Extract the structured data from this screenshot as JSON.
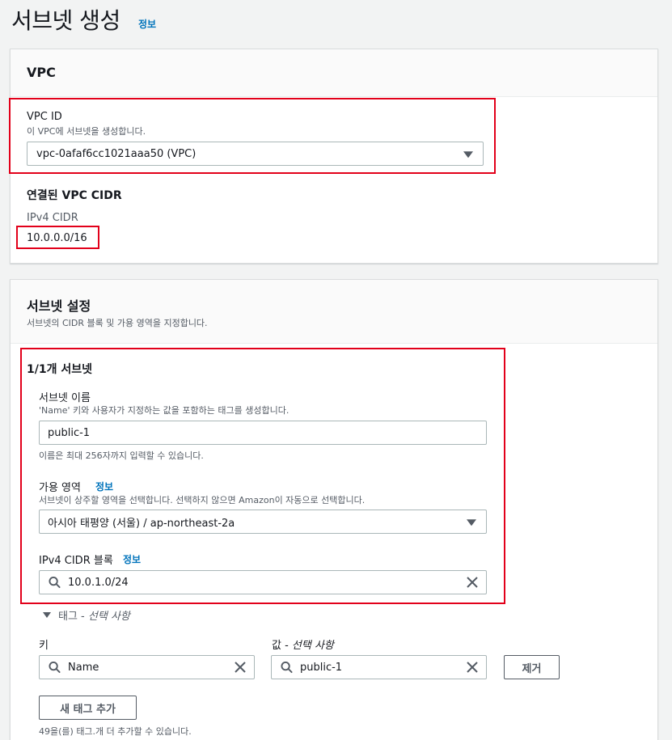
{
  "page": {
    "title": "서브넷 생성",
    "info_link": "정보"
  },
  "vpc_section": {
    "heading": "VPC",
    "vpc_id_label": "VPC ID",
    "vpc_id_description": "이 VPC에 서브넷을 생성합니다.",
    "vpc_id_value": "vpc-0afaf6cc1021aaa50 (VPC)",
    "associated_cidr_heading": "연결된 VPC CIDR",
    "ipv4_cidr_label": "IPv4 CIDR",
    "ipv4_cidr_value": "10.0.0.0/16"
  },
  "subnet_settings": {
    "heading": "서브넷 설정",
    "description": "서브넷의 CIDR 블록 및 가용 영역을 지정합니다.",
    "subnet_count_heading": "1/1개 서브넷",
    "name_label": "서브넷 이름",
    "name_description": "'Name' 키와 사용자가 지정하는 값을 포함하는 태그를 생성합니다.",
    "name_value": "public-1",
    "name_constraint": "이름은 최대 256자까지 입력할 수 있습니다.",
    "az_label": "가용 영역",
    "az_info": "정보",
    "az_description": "서브넷이 상주할 영역을 선택합니다. 선택하지 않으면 Amazon이 자동으로 선택합니다.",
    "az_value": "아시아 태평양 (서울) / ap-northeast-2a",
    "cidr_label": "IPv4 CIDR 블록",
    "cidr_info": "정보",
    "cidr_value": "10.0.1.0/24"
  },
  "tags": {
    "toggle_label": "태그 - ",
    "toggle_optional": "선택 사항",
    "key_label": "키",
    "value_label": "값 - ",
    "value_optional": "선택 사항",
    "key_value": "Name",
    "value_value": "public-1",
    "remove_button": "제거",
    "add_button": "새 태그 추가",
    "remaining_note": "49을(를) 태그.개 더 추가할 수 있습니다."
  },
  "icons": {
    "search": "search-icon",
    "clear": "close-icon",
    "dropdown": "caret-down-icon"
  },
  "colors": {
    "link": "#0073bb",
    "highlight": "#e2001a"
  }
}
